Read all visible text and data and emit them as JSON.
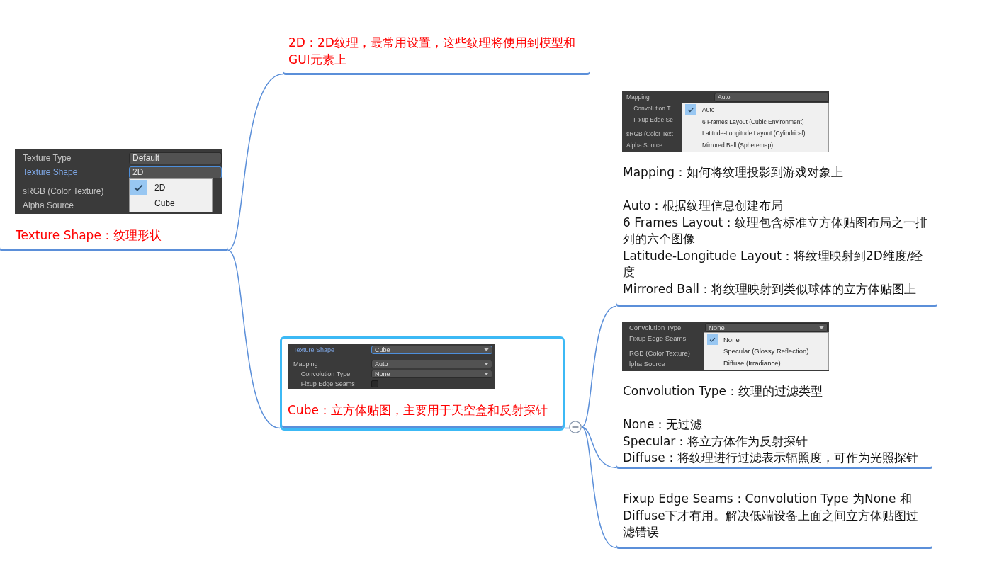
{
  "mind_map": {
    "root": {
      "text": "Texture Shape：纹理形状",
      "inspector": {
        "rows": [
          {
            "label": "Texture Type",
            "kind": "field",
            "value": "Default",
            "focused": false
          },
          {
            "label": "Texture Shape",
            "kind": "field",
            "value": "2D",
            "focused": true,
            "menu": [
              {
                "label": "2D",
                "selected": true
              },
              {
                "label": "Cube",
                "selected": false
              }
            ]
          },
          {
            "label": "sRGB (Color Texture)",
            "kind": "label",
            "focused": false
          },
          {
            "label": "Alpha Source",
            "kind": "label",
            "focused": false
          }
        ]
      },
      "children": [
        {
          "text": "2D：2D纹理，最常用设置，这些纹理将使用到模型和GUI元素上",
          "selected": false
        },
        {
          "text": "Cube：立方体贴图，主要用于天空盒和反射探针",
          "selected": true,
          "expanded": true,
          "inspector": {
            "rows": [
              {
                "label": "Texture Shape",
                "kind": "dropdown",
                "value": "Cube",
                "focused": true
              },
              {
                "label": "Mapping",
                "kind": "dropdown",
                "value": "Auto",
                "focused": false,
                "children": [
                  {
                    "label": "Convolution Type",
                    "kind": "dropdown",
                    "value": "None",
                    "focused": false
                  },
                  {
                    "label": "Fixup Edge Seams",
                    "kind": "checkbox",
                    "checked": false,
                    "focused": false
                  }
                ]
              }
            ]
          },
          "children": [
            {
              "selected": false,
              "inspector": {
                "rows": [
                  {
                    "label": "Mapping",
                    "kind": "field",
                    "value": "Auto",
                    "focused": false,
                    "menu": [
                      {
                        "label": "Auto",
                        "selected": true
                      },
                      {
                        "label": "6 Frames Layout (Cubic Environment)",
                        "selected": false
                      },
                      {
                        "label": "Latitude-Longitude Layout (Cylindrical)",
                        "selected": false
                      },
                      {
                        "label": "Mirrored Ball (Spheremap)",
                        "selected": false
                      }
                    ],
                    "children": [
                      {
                        "label": "Convolution T",
                        "kind": "label",
                        "focused": false
                      },
                      {
                        "label": "Fixup Edge Se",
                        "kind": "label",
                        "focused": false
                      }
                    ]
                  },
                  {
                    "label": "sRGB (Color Text",
                    "kind": "label",
                    "focused": false
                  },
                  {
                    "label": "Alpha Source",
                    "kind": "label",
                    "focused": false
                  }
                ]
              },
              "paragraphs": [
                [
                  "Mapping：如何将纹理投影到游戏对象上"
                ],
                [
                  "Auto：根据纹理信息创建布局",
                  "6 Frames Layout：纹理包含标准立方体贴图布局之一排列的六个图像",
                  "Latitude-Longitude Layout：将纹理映射到2D维度/经度",
                  "Mirrored Ball：将纹理映射到类似球体的立方体贴图上"
                ]
              ]
            },
            {
              "selected": false,
              "inspector": {
                "rows": [
                  {
                    "label": "Convolution Type",
                    "kind": "dropdown",
                    "value": "None",
                    "focused": false,
                    "menu": [
                      {
                        "label": "None",
                        "selected": true
                      },
                      {
                        "label": "Specular (Glossy Reflection)",
                        "selected": false
                      },
                      {
                        "label": "Diffuse (Irradiance)",
                        "selected": false
                      }
                    ]
                  },
                  {
                    "label": "Fixup Edge Seams",
                    "kind": "label",
                    "focused": false
                  },
                  {
                    "label": "RGB (Color Texture)",
                    "kind": "label",
                    "focused": false
                  },
                  {
                    "label": "lpha Source",
                    "kind": "label",
                    "focused": false
                  }
                ]
              },
              "paragraphs": [
                [
                  "Convolution Type：纹理的过滤类型"
                ],
                [
                  "None：无过滤",
                  "Specular：将立方体作为反射探针",
                  "Diffuse：将纹理进行过滤表示辐照度，可作为光照探针"
                ]
              ]
            },
            {
              "selected": false,
              "paragraphs": [
                [
                  "Fixup Edge Seams：Convolution Type 为None 和 Diffuse下才有用。解决低端设备上面之间立方体贴图过滤错误"
                ]
              ]
            }
          ]
        }
      ]
    }
  }
}
